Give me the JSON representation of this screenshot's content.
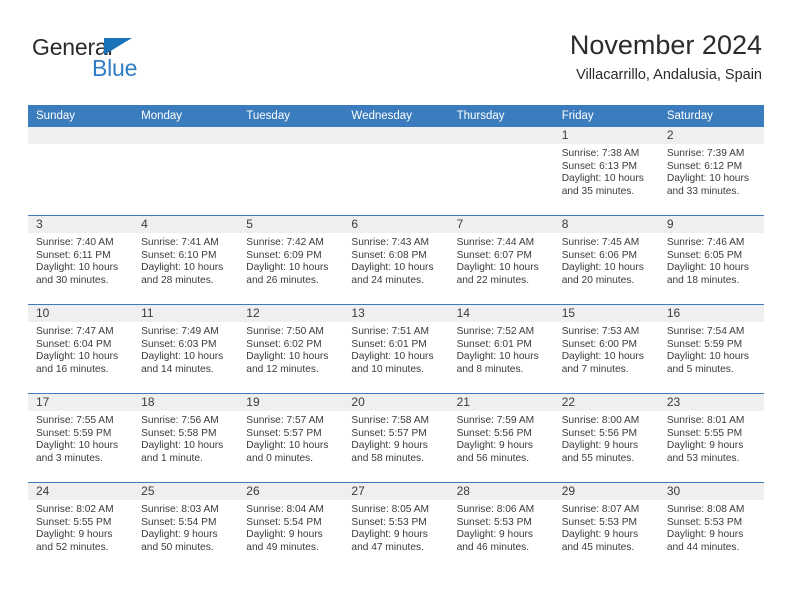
{
  "brand": {
    "name_part1": "General",
    "name_part2": "Blue",
    "triangle_color": "#1a72b8",
    "blue_text_color": "#2f7dc4"
  },
  "header": {
    "title": "November 2024",
    "subtitle": "Villacarrillo, Andalusia, Spain"
  },
  "theme": {
    "header_blue": "#3a7cbe",
    "daynum_strip": "#efefef",
    "text": "#3b3b3b"
  },
  "weekdays": [
    "Sunday",
    "Monday",
    "Tuesday",
    "Wednesday",
    "Thursday",
    "Friday",
    "Saturday"
  ],
  "labels": {
    "sunrise_prefix": "Sunrise:",
    "sunset_prefix": "Sunset:",
    "daylight_prefix": "Daylight:"
  },
  "weeks": [
    [
      {
        "day": "",
        "empty": true
      },
      {
        "day": "",
        "empty": true
      },
      {
        "day": "",
        "empty": true
      },
      {
        "day": "",
        "empty": true
      },
      {
        "day": "",
        "empty": true
      },
      {
        "day": "1",
        "sunrise": "Sunrise: 7:38 AM",
        "sunset": "Sunset: 6:13 PM",
        "daylight": "Daylight: 10 hours and 35 minutes."
      },
      {
        "day": "2",
        "sunrise": "Sunrise: 7:39 AM",
        "sunset": "Sunset: 6:12 PM",
        "daylight": "Daylight: 10 hours and 33 minutes."
      }
    ],
    [
      {
        "day": "3",
        "sunrise": "Sunrise: 7:40 AM",
        "sunset": "Sunset: 6:11 PM",
        "daylight": "Daylight: 10 hours and 30 minutes."
      },
      {
        "day": "4",
        "sunrise": "Sunrise: 7:41 AM",
        "sunset": "Sunset: 6:10 PM",
        "daylight": "Daylight: 10 hours and 28 minutes."
      },
      {
        "day": "5",
        "sunrise": "Sunrise: 7:42 AM",
        "sunset": "Sunset: 6:09 PM",
        "daylight": "Daylight: 10 hours and 26 minutes."
      },
      {
        "day": "6",
        "sunrise": "Sunrise: 7:43 AM",
        "sunset": "Sunset: 6:08 PM",
        "daylight": "Daylight: 10 hours and 24 minutes."
      },
      {
        "day": "7",
        "sunrise": "Sunrise: 7:44 AM",
        "sunset": "Sunset: 6:07 PM",
        "daylight": "Daylight: 10 hours and 22 minutes."
      },
      {
        "day": "8",
        "sunrise": "Sunrise: 7:45 AM",
        "sunset": "Sunset: 6:06 PM",
        "daylight": "Daylight: 10 hours and 20 minutes."
      },
      {
        "day": "9",
        "sunrise": "Sunrise: 7:46 AM",
        "sunset": "Sunset: 6:05 PM",
        "daylight": "Daylight: 10 hours and 18 minutes."
      }
    ],
    [
      {
        "day": "10",
        "sunrise": "Sunrise: 7:47 AM",
        "sunset": "Sunset: 6:04 PM",
        "daylight": "Daylight: 10 hours and 16 minutes."
      },
      {
        "day": "11",
        "sunrise": "Sunrise: 7:49 AM",
        "sunset": "Sunset: 6:03 PM",
        "daylight": "Daylight: 10 hours and 14 minutes."
      },
      {
        "day": "12",
        "sunrise": "Sunrise: 7:50 AM",
        "sunset": "Sunset: 6:02 PM",
        "daylight": "Daylight: 10 hours and 12 minutes."
      },
      {
        "day": "13",
        "sunrise": "Sunrise: 7:51 AM",
        "sunset": "Sunset: 6:01 PM",
        "daylight": "Daylight: 10 hours and 10 minutes."
      },
      {
        "day": "14",
        "sunrise": "Sunrise: 7:52 AM",
        "sunset": "Sunset: 6:01 PM",
        "daylight": "Daylight: 10 hours and 8 minutes."
      },
      {
        "day": "15",
        "sunrise": "Sunrise: 7:53 AM",
        "sunset": "Sunset: 6:00 PM",
        "daylight": "Daylight: 10 hours and 7 minutes."
      },
      {
        "day": "16",
        "sunrise": "Sunrise: 7:54 AM",
        "sunset": "Sunset: 5:59 PM",
        "daylight": "Daylight: 10 hours and 5 minutes."
      }
    ],
    [
      {
        "day": "17",
        "sunrise": "Sunrise: 7:55 AM",
        "sunset": "Sunset: 5:59 PM",
        "daylight": "Daylight: 10 hours and 3 minutes."
      },
      {
        "day": "18",
        "sunrise": "Sunrise: 7:56 AM",
        "sunset": "Sunset: 5:58 PM",
        "daylight": "Daylight: 10 hours and 1 minute."
      },
      {
        "day": "19",
        "sunrise": "Sunrise: 7:57 AM",
        "sunset": "Sunset: 5:57 PM",
        "daylight": "Daylight: 10 hours and 0 minutes."
      },
      {
        "day": "20",
        "sunrise": "Sunrise: 7:58 AM",
        "sunset": "Sunset: 5:57 PM",
        "daylight": "Daylight: 9 hours and 58 minutes."
      },
      {
        "day": "21",
        "sunrise": "Sunrise: 7:59 AM",
        "sunset": "Sunset: 5:56 PM",
        "daylight": "Daylight: 9 hours and 56 minutes."
      },
      {
        "day": "22",
        "sunrise": "Sunrise: 8:00 AM",
        "sunset": "Sunset: 5:56 PM",
        "daylight": "Daylight: 9 hours and 55 minutes."
      },
      {
        "day": "23",
        "sunrise": "Sunrise: 8:01 AM",
        "sunset": "Sunset: 5:55 PM",
        "daylight": "Daylight: 9 hours and 53 minutes."
      }
    ],
    [
      {
        "day": "24",
        "sunrise": "Sunrise: 8:02 AM",
        "sunset": "Sunset: 5:55 PM",
        "daylight": "Daylight: 9 hours and 52 minutes."
      },
      {
        "day": "25",
        "sunrise": "Sunrise: 8:03 AM",
        "sunset": "Sunset: 5:54 PM",
        "daylight": "Daylight: 9 hours and 50 minutes."
      },
      {
        "day": "26",
        "sunrise": "Sunrise: 8:04 AM",
        "sunset": "Sunset: 5:54 PM",
        "daylight": "Daylight: 9 hours and 49 minutes."
      },
      {
        "day": "27",
        "sunrise": "Sunrise: 8:05 AM",
        "sunset": "Sunset: 5:53 PM",
        "daylight": "Daylight: 9 hours and 47 minutes."
      },
      {
        "day": "28",
        "sunrise": "Sunrise: 8:06 AM",
        "sunset": "Sunset: 5:53 PM",
        "daylight": "Daylight: 9 hours and 46 minutes."
      },
      {
        "day": "29",
        "sunrise": "Sunrise: 8:07 AM",
        "sunset": "Sunset: 5:53 PM",
        "daylight": "Daylight: 9 hours and 45 minutes."
      },
      {
        "day": "30",
        "sunrise": "Sunrise: 8:08 AM",
        "sunset": "Sunset: 5:53 PM",
        "daylight": "Daylight: 9 hours and 44 minutes."
      }
    ]
  ]
}
